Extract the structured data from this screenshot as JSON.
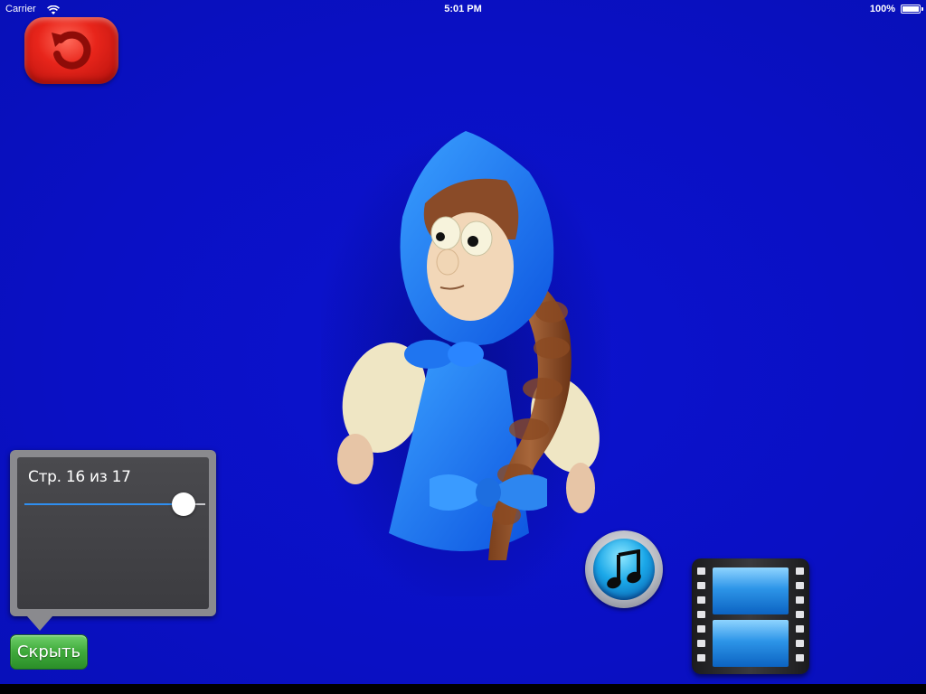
{
  "status_bar": {
    "carrier": "Carrier",
    "time": "5:01 PM",
    "battery": "100%",
    "battery_level": 1.0,
    "icons": [
      "wifi-icon",
      "battery-icon"
    ]
  },
  "toolbar": {
    "back_icon": "undo-arrow-icon",
    "back_color": "#e02418"
  },
  "illustration": {
    "subject": "clay-figure"
  },
  "page_panel": {
    "label": "Стр. 16 из 17",
    "current_page": 16,
    "total_pages": 17,
    "slider_fraction": 0.88,
    "accent_color": "#2f8ff0"
  },
  "hide_button": {
    "label": "Скрыть",
    "color": "#3ea93a"
  },
  "media_buttons": {
    "music_icon": "music-note-icon",
    "video_icon": "film-strip-icon"
  },
  "background_color": "#0a10c4"
}
